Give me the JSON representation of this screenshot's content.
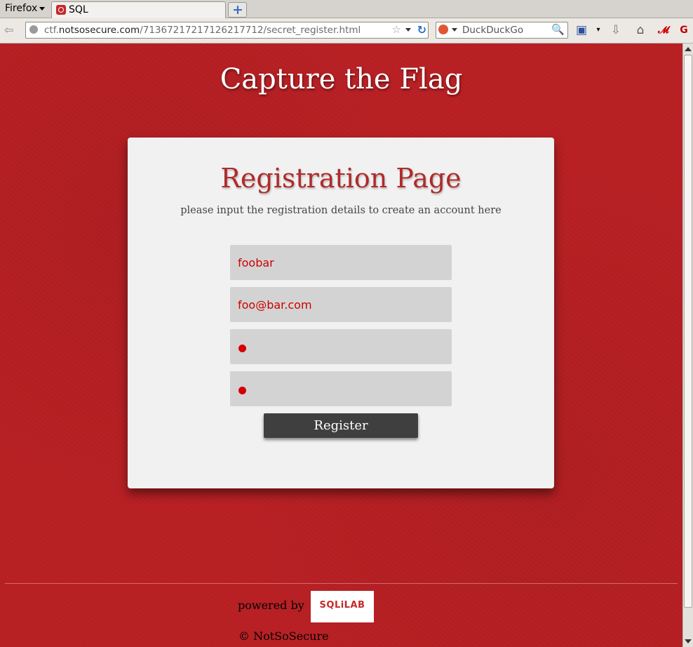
{
  "browser": {
    "menu_label": "Firefox",
    "tab_title": "SQL",
    "url_prefix": "ctf.",
    "url_domain": "notsosecure.com",
    "url_path": "/71367217217126217712/secret_register.html",
    "search_engine": "DuckDuckGo"
  },
  "page": {
    "site_title": "Capture the Flag",
    "heading": "Registration Page",
    "subtitle": "please input the registration details to create an account here",
    "fields": {
      "username": "foobar",
      "email": "foo@bar.com"
    },
    "register_label": "Register",
    "powered_by": "powered by",
    "logo_text": "SQLiLAB",
    "copyright": "© NotSoSecure"
  },
  "colors": {
    "background": "#b71f23",
    "card": "#f1f1f1",
    "heading": "#b02a2a",
    "field_bg": "#d3d3d3",
    "field_text": "#cc0000",
    "button": "#3f3f3f"
  }
}
